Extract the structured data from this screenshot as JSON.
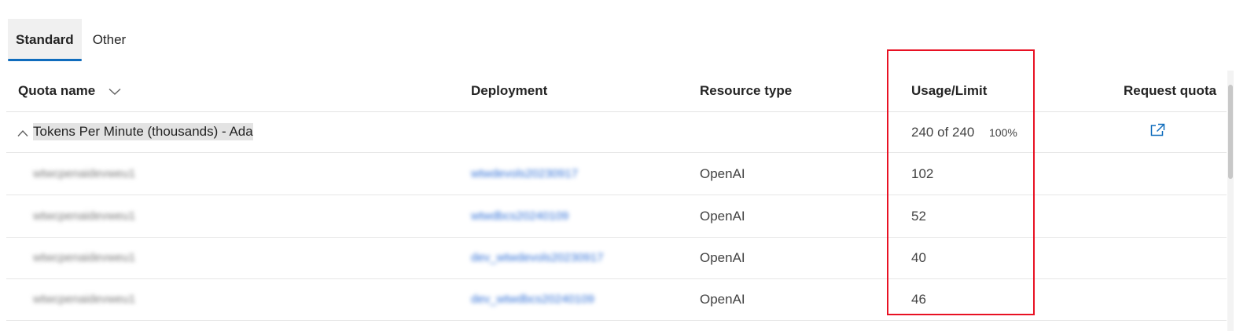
{
  "tabs": [
    {
      "label": "Standard",
      "active": true
    },
    {
      "label": "Other",
      "active": false
    }
  ],
  "table": {
    "columns": {
      "quota_name": "Quota name",
      "deployment": "Deployment",
      "resource_type": "Resource type",
      "usage_limit": "Usage/Limit",
      "request_quota": "Request quota"
    },
    "group": {
      "label": "Tokens Per Minute (thousands) - Ada",
      "usage": "240 of 240",
      "percent": "100%"
    },
    "rows": [
      {
        "quota_name": "wtwcpenaidevweu1",
        "deployment": "wtwdevols20230917",
        "resource_type": "OpenAI",
        "usage": "102"
      },
      {
        "quota_name": "wtwcpenaidevweu1",
        "deployment": "wtwdbcs20240109",
        "resource_type": "OpenAI",
        "usage": "52"
      },
      {
        "quota_name": "wtwcpenaidevweu1",
        "deployment": "dev_wtwdevols20230917",
        "resource_type": "OpenAI",
        "usage": "40"
      },
      {
        "quota_name": "wtwcpenaidevweu1",
        "deployment": "dev_wtwdbcs20240109",
        "resource_type": "OpenAI",
        "usage": "46"
      }
    ]
  },
  "colors": {
    "accent": "#0f6cbd",
    "highlight": "#e81123"
  },
  "icons": {
    "sort": "chevron-down-icon",
    "collapse": "chevron-up-icon",
    "request": "open-external-icon"
  }
}
